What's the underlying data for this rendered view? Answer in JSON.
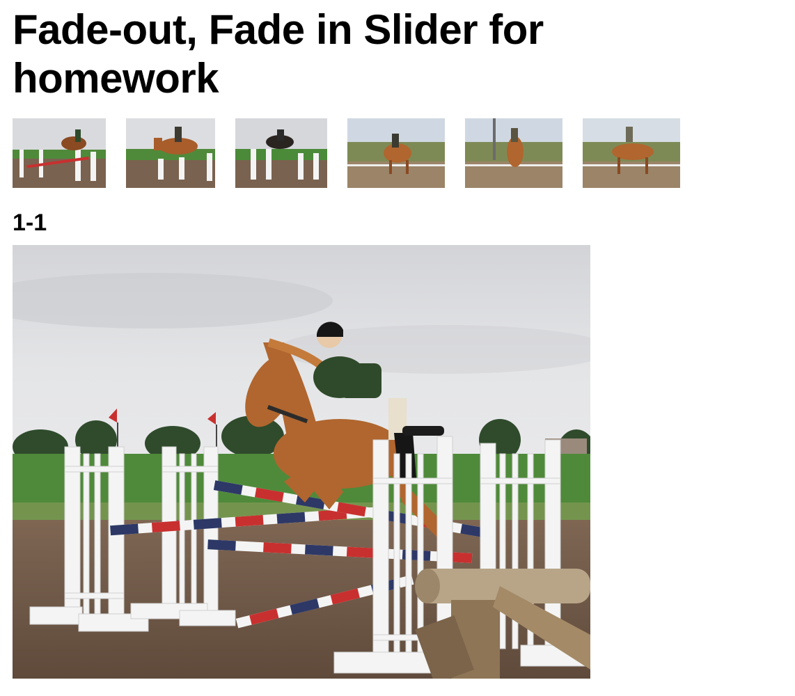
{
  "page": {
    "title": "Fade-out, Fade in Slider for homework"
  },
  "slider": {
    "current_caption": "1-1",
    "thumbnails": [
      {
        "name": "thumb-1",
        "scene": "show jumping over white fence"
      },
      {
        "name": "thumb-2",
        "scene": "show jumping approach"
      },
      {
        "name": "thumb-3",
        "scene": "show jumping, dark horse"
      },
      {
        "name": "thumb-4",
        "scene": "dressage trot"
      },
      {
        "name": "thumb-5",
        "scene": "rearing horse"
      },
      {
        "name": "thumb-6",
        "scene": "dressage canter"
      }
    ]
  },
  "colors": {
    "sky": "#dcdde0",
    "grass": "#4f8a3a",
    "dirt": "#7a6250",
    "horse": "#b0662e",
    "pole_red": "#c8302f",
    "pole_blue": "#2d3866"
  }
}
